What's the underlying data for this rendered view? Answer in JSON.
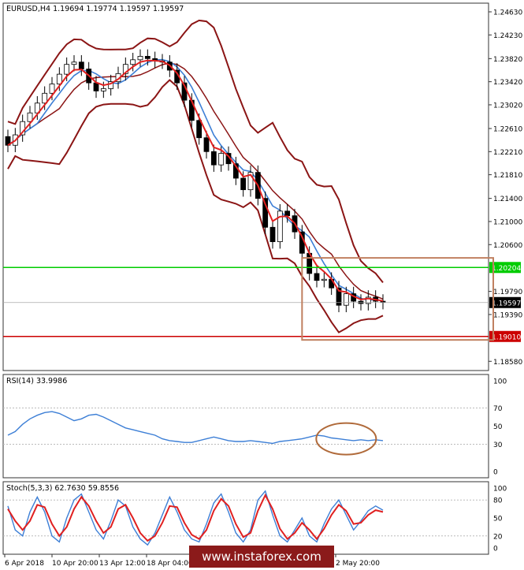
{
  "chart_data": [
    {
      "type": "candlestick",
      "title": "EURUSD,H4  1.19694 1.19774 1.19597 1.19597",
      "symbol": "EURUSD,H4",
      "ohlc_label": {
        "open": 1.19694,
        "high": 1.19774,
        "low": 1.19597,
        "close": 1.19597
      },
      "ylim": [
        1.1842,
        1.2478
      ],
      "y_ticks": [
        "1.24630",
        "1.24230",
        "1.23820",
        "1.23420",
        "1.23020",
        "1.22610",
        "1.22210",
        "1.21810",
        "1.21400",
        "1.21000",
        "1.20600",
        "1.20204",
        "1.19790",
        "1.19597",
        "1.19390",
        "1.19010",
        "1.18580"
      ],
      "current_price": "1.19597",
      "levels": [
        {
          "name": "resistance",
          "value": 1.20204,
          "label": "1.20204",
          "color": "#00cc00"
        },
        {
          "name": "support",
          "value": 1.1901,
          "label": "1.19010",
          "color": "#cc0000"
        }
      ],
      "highlight_box": {
        "x_range": [
          40,
          66
        ],
        "y_range": [
          1.1895,
          1.2037
        ],
        "color": "#c08060"
      },
      "x_ticks": [
        "6 Apr 2018",
        "10 Apr 20:00",
        "13 Apr 12:00",
        "18 Apr 04:00",
        "",
        "",
        "",
        "2 May 20:00"
      ],
      "closes": [
        1.2232,
        1.225,
        1.2273,
        1.2288,
        1.2305,
        1.2322,
        1.2338,
        1.2355,
        1.2372,
        1.2376,
        1.2364,
        1.234,
        1.2326,
        1.233,
        1.2342,
        1.2356,
        1.2372,
        1.238,
        1.2386,
        1.2382,
        1.2378,
        1.2376,
        1.2362,
        1.234,
        1.231,
        1.2275,
        1.2245,
        1.2221,
        1.2198,
        1.2218,
        1.22,
        1.2175,
        1.2155,
        1.2185,
        1.214,
        1.209,
        1.2065,
        1.2118,
        1.211,
        1.2082,
        1.2045,
        1.201,
        1.1998,
        1.2,
        1.1985,
        1.1955,
        1.1975,
        1.1962,
        1.1958,
        1.1969,
        1.1962,
        1.196
      ],
      "indicators": [
        {
          "name": "EMA (red)",
          "color": "#e02020"
        },
        {
          "name": "MA (blue)",
          "color": "#3d7fd6"
        },
        {
          "name": "Bollinger Bands",
          "color": "#8b1515"
        }
      ]
    },
    {
      "type": "line",
      "title": "RSI(14) 33.9986",
      "ylim": [
        0,
        100
      ],
      "y_ticks": [
        "100",
        "70",
        "50",
        "30",
        "0"
      ],
      "series": [
        {
          "name": "RSI(14)",
          "color": "#3d7fd6",
          "values": [
            40,
            44,
            52,
            58,
            62,
            65,
            66,
            64,
            60,
            56,
            58,
            62,
            63,
            60,
            56,
            52,
            48,
            46,
            44,
            42,
            40,
            36,
            34,
            33,
            32,
            32,
            34,
            36,
            38,
            36,
            34,
            33,
            33,
            34,
            33,
            32,
            31,
            33,
            34,
            35,
            36,
            38,
            40,
            39,
            37,
            36,
            35,
            34,
            35,
            34,
            35,
            34
          ]
        }
      ],
      "annotation_ellipse": {
        "x_center": 46,
        "y_center": 36
      }
    },
    {
      "type": "line",
      "title": "Stoch(5,3,3) 62.7630 59.8556",
      "ylim": [
        0,
        100
      ],
      "y_ticks": [
        "100",
        "80",
        "50",
        "20",
        "0"
      ],
      "series": [
        {
          "name": "%K",
          "color": "#3d7fd6",
          "values": [
            70,
            30,
            20,
            60,
            85,
            60,
            20,
            10,
            50,
            80,
            90,
            60,
            30,
            15,
            45,
            80,
            70,
            35,
            15,
            5,
            25,
            55,
            85,
            60,
            30,
            15,
            10,
            40,
            75,
            90,
            60,
            25,
            10,
            30,
            80,
            95,
            55,
            20,
            10,
            30,
            50,
            20,
            10,
            40,
            65,
            80,
            55,
            30,
            45,
            62,
            70,
            63
          ]
        },
        {
          "name": "%D",
          "color": "#e02020",
          "values": [
            65,
            45,
            30,
            45,
            72,
            68,
            40,
            20,
            35,
            65,
            85,
            70,
            45,
            25,
            35,
            65,
            72,
            50,
            25,
            12,
            20,
            42,
            70,
            68,
            42,
            22,
            15,
            30,
            62,
            82,
            70,
            40,
            18,
            25,
            62,
            88,
            65,
            32,
            15,
            25,
            42,
            30,
            15,
            32,
            55,
            72,
            62,
            40,
            42,
            55,
            63,
            60
          ]
        }
      ]
    }
  ],
  "watermark": "www.instaforex.com"
}
